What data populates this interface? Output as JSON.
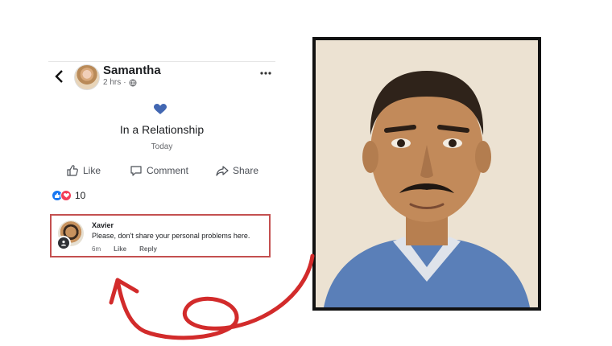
{
  "post": {
    "author": "Samantha",
    "time": "2 hrs",
    "status": "In a Relationship",
    "date": "Today",
    "actions": {
      "like": "Like",
      "comment": "Comment",
      "share": "Share"
    },
    "reaction_count": "10"
  },
  "comment": {
    "author": "Xavier",
    "text": "Please, don't share your personal problems here.",
    "time": "6m",
    "like": "Like",
    "reply": "Reply"
  },
  "colors": {
    "heart": "#4267b2",
    "highlight_border": "#c45050",
    "arrow": "#d22b2b",
    "like_reaction": "#1877f2",
    "love_reaction": "#f33e58"
  },
  "icons": [
    "back-arrow-icon",
    "globe-icon",
    "more-icon",
    "heart-icon",
    "like-icon",
    "comment-icon",
    "share-icon",
    "user-badge-icon"
  ]
}
